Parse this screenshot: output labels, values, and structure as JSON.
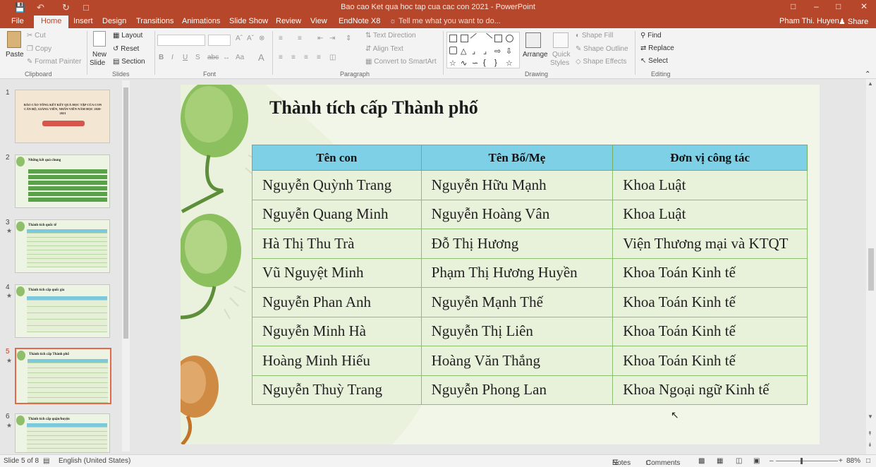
{
  "window": {
    "title": "Bao cao Ket qua hoc tap cua cac con 2021 - PowerPoint",
    "user": "Pham Thi. Huyen",
    "share_label": "Share"
  },
  "tabs": [
    "File",
    "Home",
    "Insert",
    "Design",
    "Transitions",
    "Animations",
    "Slide Show",
    "Review",
    "View",
    "EndNote X8"
  ],
  "active_tab": "Home",
  "tell_me": "Tell me what you want to do...",
  "ribbon": {
    "clipboard": {
      "label": "Clipboard",
      "paste": "Paste",
      "cut": "Cut",
      "copy": "Copy",
      "format_painter": "Format Painter"
    },
    "slides": {
      "label": "Slides",
      "new_slide_1": "New",
      "new_slide_2": "Slide",
      "layout": "Layout",
      "reset": "Reset",
      "section": "Section"
    },
    "font": {
      "label": "Font"
    },
    "paragraph": {
      "label": "Paragraph",
      "text_direction": "Text Direction",
      "align_text": "Align Text",
      "convert_smartart": "Convert to SmartArt"
    },
    "drawing": {
      "label": "Drawing",
      "arrange": "Arrange",
      "quick_styles_1": "Quick",
      "quick_styles_2": "Styles",
      "shape_fill": "Shape Fill",
      "shape_outline": "Shape Outline",
      "shape_effects": "Shape Effects"
    },
    "editing": {
      "label": "Editing",
      "find": "Find",
      "replace": "Replace",
      "select": "Select"
    }
  },
  "thumbnails": [
    {
      "num": "1",
      "title": "BÁO CÁO TỔNG KẾT KẾT QUẢ HỌC TẬP CỦA CON CÁN BỘ, GIẢNG VIÊN, NHÂN VIÊN NĂM HỌC 2020-2021",
      "star": false
    },
    {
      "num": "2",
      "title": "Những kết quả chung",
      "star": false
    },
    {
      "num": "3",
      "title": "Thành tích quốc tế",
      "star": true
    },
    {
      "num": "4",
      "title": "Thành tích cấp quốc gia",
      "star": true
    },
    {
      "num": "5",
      "title": "Thành tích cấp Thành phố",
      "star": true
    },
    {
      "num": "6",
      "title": "Thành tích cấp quận/huyện",
      "star": true
    }
  ],
  "slide": {
    "title": "Thành tích cấp Thành phố",
    "headers": [
      "Tên con",
      "Tên Bố/Mẹ",
      "Đơn vị công tác"
    ],
    "rows": [
      [
        "Nguyễn Quỳnh Trang",
        "Nguyễn Hữu Mạnh",
        "Khoa Luật"
      ],
      [
        "Nguyễn Quang Minh",
        "Nguyễn Hoàng Vân",
        "Khoa Luật"
      ],
      [
        "Hà Thị Thu Trà",
        "Đỗ Thị Hương",
        "Viện Thương mại và KTQT"
      ],
      [
        "Vũ Nguyệt Minh",
        "Phạm Thị Hương Huyền",
        "Khoa Toán Kinh tế"
      ],
      [
        "Nguyễn Phan Anh",
        "Nguyễn Mạnh Thế",
        "Khoa Toán Kinh tế"
      ],
      [
        "Nguyễn Minh Hà",
        "Nguyễn Thị Liên",
        "Khoa Toán Kinh tế"
      ],
      [
        "Hoàng Minh Hiếu",
        "Hoàng Văn Thắng",
        "Khoa Toán Kinh tế"
      ],
      [
        "Nguyễn Thuỳ Trang",
        "Nguyễn Phong Lan",
        "Khoa Ngoại ngữ Kinh tế"
      ]
    ]
  },
  "status": {
    "slide_info": "Slide 5 of 8",
    "language": "English (United States)",
    "notes": "Notes",
    "comments": "Comments",
    "zoom": "88%"
  }
}
